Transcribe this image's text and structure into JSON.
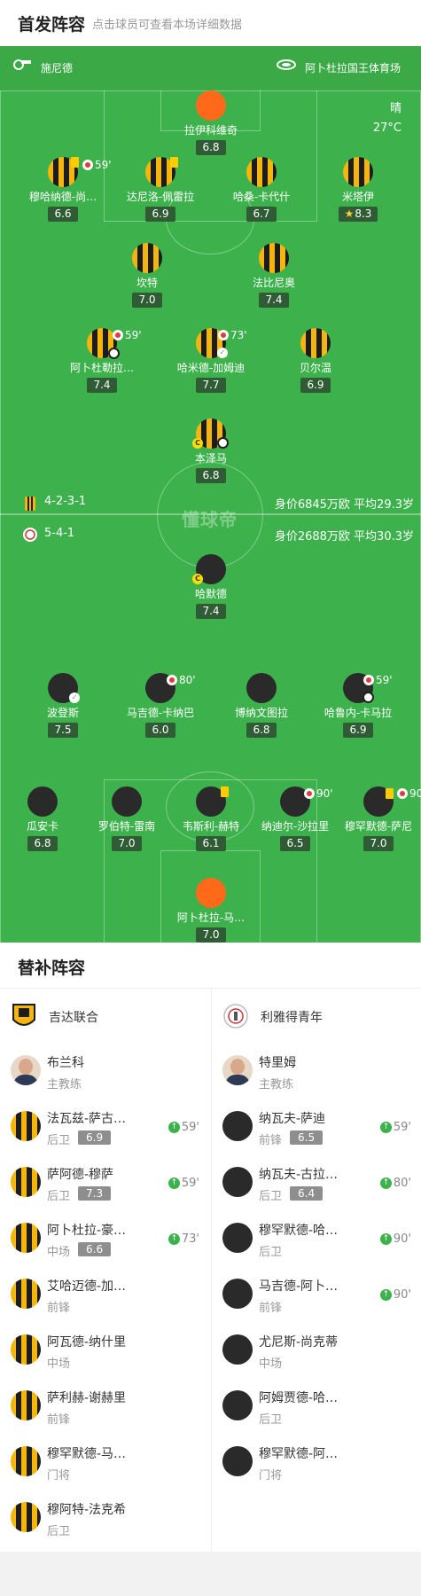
{
  "header": {
    "title": "首发阵容",
    "subtitle": "点击球员可查看本场详细数据"
  },
  "info": {
    "referee": "施尼德",
    "stadium": "阿卜杜拉国王体育场",
    "weather": "晴",
    "temperature": "27°C"
  },
  "watermark": "懂球帝",
  "home": {
    "formation": "4-2-3-1",
    "value": "身价6845万欧 平均29.3岁"
  },
  "away": {
    "formation": "5-4-1",
    "value": "身价2688万欧 平均30.3岁"
  },
  "home_players": [
    {
      "name": "拉伊科维奇",
      "rating": "6.8"
    },
    {
      "name": "穆哈纳德-尚…",
      "rating": "6.6",
      "sub": "59'"
    },
    {
      "name": "达尼洛-佩雷拉",
      "rating": "6.9"
    },
    {
      "name": "哈桑-卡代什",
      "rating": "6.7"
    },
    {
      "name": "米塔伊",
      "rating": "8.3"
    },
    {
      "name": "坎特",
      "rating": "7.0"
    },
    {
      "name": "法比尼奥",
      "rating": "7.4"
    },
    {
      "name": "阿卜杜勒拉…",
      "rating": "7.4",
      "sub": "59'"
    },
    {
      "name": "哈米德-加姆迪",
      "rating": "7.7",
      "sub": "73'"
    },
    {
      "name": "贝尔温",
      "rating": "6.9"
    },
    {
      "name": "本泽马",
      "rating": "6.8",
      "captain": "C"
    }
  ],
  "away_players": [
    {
      "name": "哈默德",
      "rating": "7.4",
      "captain": "C"
    },
    {
      "name": "波登斯",
      "rating": "7.5"
    },
    {
      "name": "马吉德-卡纳巴",
      "rating": "6.0",
      "sub": "80'"
    },
    {
      "name": "博纳文图拉",
      "rating": "6.8"
    },
    {
      "name": "哈鲁内-卡马拉",
      "rating": "6.9",
      "sub": "59'"
    },
    {
      "name": "瓜安卡",
      "rating": "6.8"
    },
    {
      "name": "罗伯特-雷南",
      "rating": "7.0"
    },
    {
      "name": "韦斯利-赫特",
      "rating": "6.1"
    },
    {
      "name": "纳迪尔-沙拉里",
      "rating": "6.5",
      "sub": "90'"
    },
    {
      "name": "穆罕默德-萨尼",
      "rating": "7.0",
      "sub": "90'"
    },
    {
      "name": "阿卜杜拉-马…",
      "rating": "7.0"
    }
  ],
  "subs_title": "替补阵容",
  "subs_home": {
    "team": "吉达联合",
    "coach": {
      "name": "布兰科",
      "role": "主教练"
    },
    "players": [
      {
        "name": "法瓦兹-萨古…",
        "pos": "后卫",
        "rating": "6.9",
        "minute": "59'"
      },
      {
        "name": "萨阿德-穆萨",
        "pos": "后卫",
        "rating": "7.3",
        "minute": "59'"
      },
      {
        "name": "阿卜杜拉-豪…",
        "pos": "中场",
        "rating": "6.6",
        "minute": "73'"
      },
      {
        "name": "艾哈迈德-加…",
        "pos": "前锋"
      },
      {
        "name": "阿瓦德-纳什里",
        "pos": "中场"
      },
      {
        "name": "萨利赫-谢赫里",
        "pos": "前锋"
      },
      {
        "name": "穆罕默德-马…",
        "pos": "门将"
      },
      {
        "name": "穆阿特-法克希",
        "pos": "后卫"
      }
    ]
  },
  "subs_away": {
    "team": "利雅得青年",
    "coach": {
      "name": "特里姆",
      "role": "主教练"
    },
    "players": [
      {
        "name": "纳瓦夫-萨迪",
        "pos": "前锋",
        "rating": "6.5",
        "minute": "59'"
      },
      {
        "name": "纳瓦夫-古拉…",
        "pos": "后卫",
        "rating": "6.4",
        "minute": "80'"
      },
      {
        "name": "穆罕默德-哈…",
        "pos": "后卫",
        "minute": "90'"
      },
      {
        "name": "马吉德-阿卜…",
        "pos": "前锋",
        "minute": "90'"
      },
      {
        "name": "尤尼斯-尚克蒂",
        "pos": "中场"
      },
      {
        "name": "阿姆贾德-哈…",
        "pos": "后卫"
      },
      {
        "name": "穆罕默德-阿…",
        "pos": "门将"
      }
    ]
  }
}
